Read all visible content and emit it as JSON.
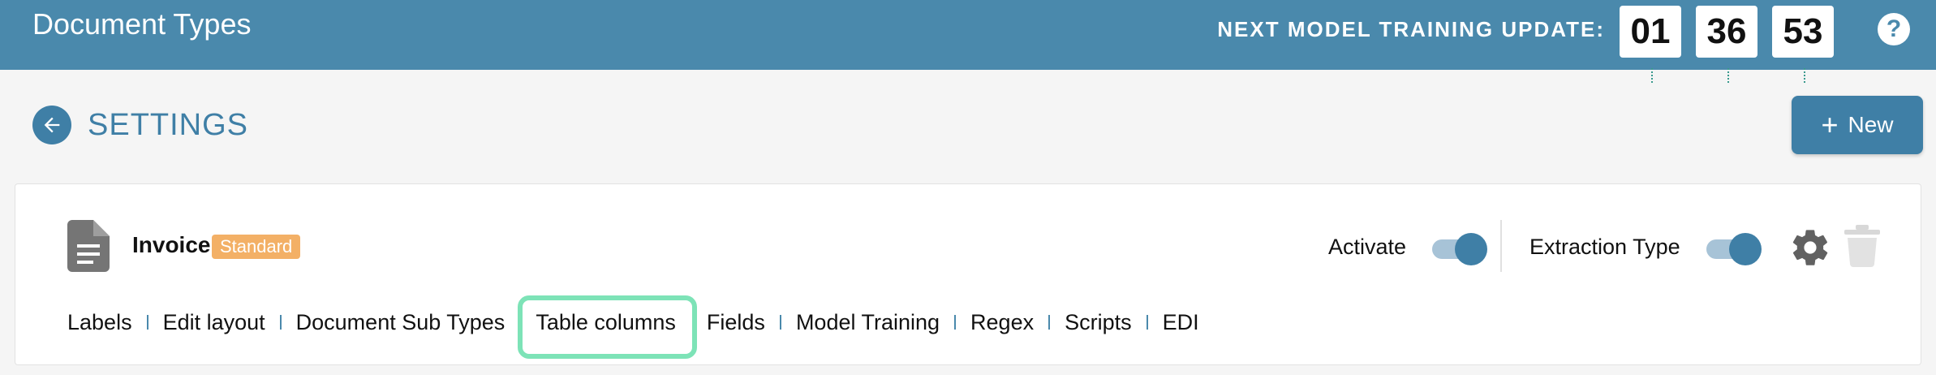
{
  "header": {
    "title": "Document Types",
    "timer_label": "NEXT MODEL TRAINING UPDATE:",
    "timer": {
      "hours": "01",
      "minutes": "36",
      "seconds": "53"
    },
    "help_icon": "help-icon",
    "help_label": "?"
  },
  "page": {
    "heading": "SETTINGS",
    "back_icon": "back-arrow-icon",
    "new_button": {
      "plus": "+",
      "label": "New"
    }
  },
  "document": {
    "name": "Invoice",
    "badge": "Standard",
    "activate_label": "Activate",
    "activate_on": true,
    "extraction_label": "Extraction Type",
    "extraction_on": true,
    "tabs": [
      "Labels",
      "Edit layout",
      "Document Sub Types",
      "Table columns",
      "Fields",
      "Model Training",
      "Regex",
      "Scripts",
      "EDI"
    ],
    "active_tab": "Table columns"
  },
  "colors": {
    "header_bg": "#4a89ac",
    "accent": "#3f7fa6",
    "badge": "#f3b066",
    "highlight": "#7de3b7"
  }
}
